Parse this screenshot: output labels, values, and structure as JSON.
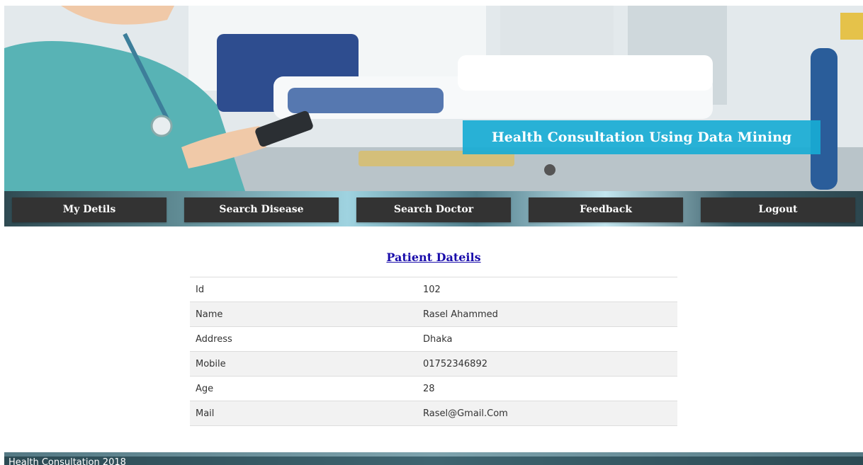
{
  "banner": {
    "title": "Health Consultation Using Data Mining",
    "title_bg_color": "#18abd4",
    "image": "hospital-nurse-photo"
  },
  "nav": {
    "items": [
      {
        "label": "My Detils",
        "icon": ""
      },
      {
        "label": "Search Disease",
        "icon": ""
      },
      {
        "label": "Search Doctor",
        "icon": ""
      },
      {
        "label": "Feedback",
        "icon": ""
      },
      {
        "label": "Logout",
        "icon": ""
      }
    ],
    "button_color": "#333333"
  },
  "patient": {
    "title": "Patient Dateils",
    "rows": [
      {
        "label": "Id",
        "value": "102"
      },
      {
        "label": "Name",
        "value": "Rasel Ahammed"
      },
      {
        "label": "Address",
        "value": "Dhaka"
      },
      {
        "label": "Mobile",
        "value": "01752346892"
      },
      {
        "label": "Age",
        "value": "28"
      },
      {
        "label": "Mail",
        "value": "Rasel@Gmail.Com"
      }
    ]
  },
  "footer": {
    "text": "Health Consultation 2018"
  }
}
